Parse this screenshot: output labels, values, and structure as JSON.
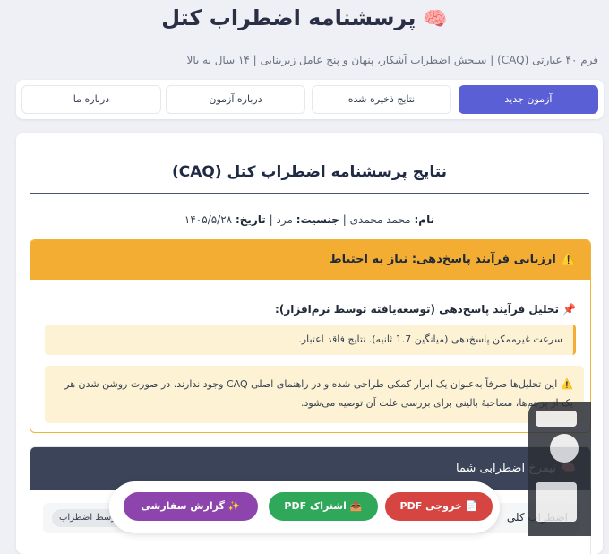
{
  "header": {
    "brain_icon": "🧠",
    "title": "پرسشنامه اضطراب کتل",
    "subtitle": "فرم ۴۰ عبارتی (CAQ) | سنجش اضطراب آشکار، پنهان و پنج عامل زیربنایی | ۱۴ سال به بالا"
  },
  "tabs": [
    {
      "label": "آزمون جدید",
      "active": true
    },
    {
      "label": "نتایج ذخیره شده",
      "active": false
    },
    {
      "label": "درباره آزمون",
      "active": false
    },
    {
      "label": "درباره ما",
      "active": false
    }
  ],
  "result": {
    "title": "نتایج پرسشنامه اضطراب کتل (CAQ)",
    "name_label": "نام:",
    "name_value": "محمد محمدی",
    "gender_label": "جنسیت:",
    "gender_value": "مرد",
    "date_label": "تاریخ:",
    "date_value": "۱۴۰۵/۵/۲۸",
    "separator": "|"
  },
  "assessment": {
    "warning_icon": "⚠️",
    "header": "ارزیابی فرآیند پاسخ‌دهی: نیاز به احتیاط",
    "pin_icon": "📌",
    "analysis_title": "تحلیل فرآیند پاسخ‌دهی (توسعه‌یافته توسط نرم‌افزار):",
    "speed_note": "سرعت غیرممکن پاسخ‌دهی (میانگین 1.7 ثانیه). نتایج فاقد اعتبار.",
    "disclaimer": "این تحلیل‌ها صرفاً به‌عنوان یک ابزار کمکی طراحی شده و در راهنمای اصلی CAQ وجود ندارند. در صورت روشن شدن هر یک از پرچم‌ها، مصاحبهٔ بالینی برای بررسی علت آن توصیه می‌شود."
  },
  "profile": {
    "icon": "🧠",
    "header": "نیمرخ اضطرابی شما",
    "row_label": "اضطراب کلی",
    "row_badge": "متوسط اضطراب"
  },
  "actions": {
    "pdf_icon": "📄",
    "pdf_label": "خروجی PDF",
    "share_icon": "📤",
    "share_label": "اشتراک PDF",
    "report_icon": "✨",
    "report_label": "گزارش سفارشی"
  },
  "colors": {
    "accent": "#5a5fd6",
    "warning": "#f4ad33",
    "pdf": "#d64541",
    "share": "#2fa85a",
    "report": "#8e44ad",
    "profile_header": "#3b4458"
  }
}
